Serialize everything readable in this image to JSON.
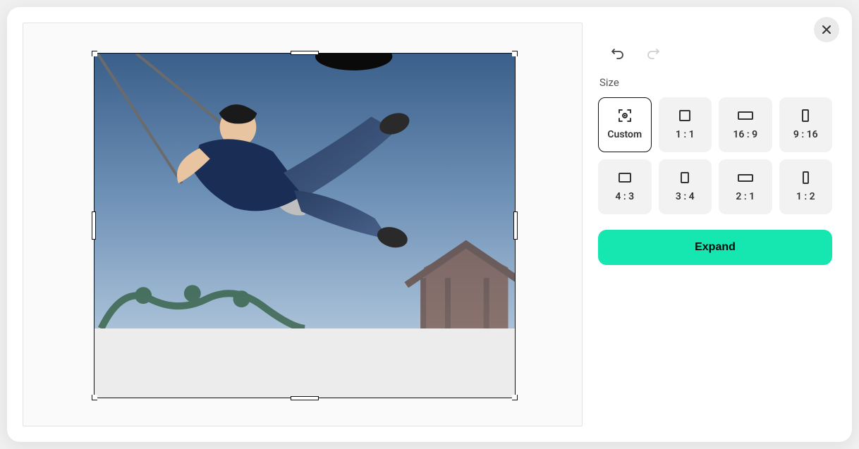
{
  "section_label": "Size",
  "expand_label": "Expand",
  "history": {
    "undo_enabled": true,
    "redo_enabled": false
  },
  "size_options": [
    {
      "id": "custom",
      "label": "Custom",
      "active": true,
      "w": 0,
      "h": 0
    },
    {
      "id": "1-1",
      "label": "1 : 1",
      "active": false,
      "w": 16,
      "h": 16
    },
    {
      "id": "16-9",
      "label": "16 : 9",
      "active": false,
      "w": 22,
      "h": 12
    },
    {
      "id": "9-16",
      "label": "9 : 16",
      "active": false,
      "w": 10,
      "h": 18
    },
    {
      "id": "4-3",
      "label": "4 : 3",
      "active": false,
      "w": 18,
      "h": 14
    },
    {
      "id": "3-4",
      "label": "3 : 4",
      "active": false,
      "w": 12,
      "h": 16
    },
    {
      "id": "2-1",
      "label": "2 : 1",
      "active": false,
      "w": 22,
      "h": 11
    },
    {
      "id": "1-2",
      "label": "1 : 2",
      "active": false,
      "w": 9,
      "h": 18
    }
  ],
  "colors": {
    "primary_action": "#16e6b0"
  }
}
